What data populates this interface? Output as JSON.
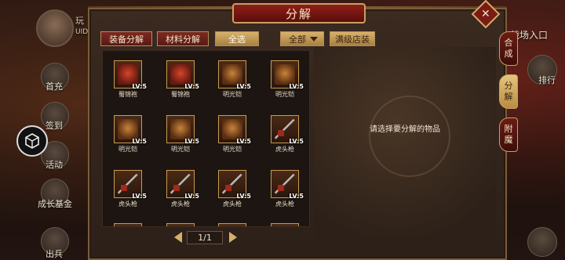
{
  "window": {
    "title": "分解",
    "close_label": "✕"
  },
  "hud": {
    "left_name": "玩",
    "left_uid": "UID",
    "left_buttons": [
      "首充",
      "签到",
      "活动",
      "成长基金",
      "出兵"
    ],
    "right_title": "战场入口",
    "right_buttons": [
      "排行"
    ]
  },
  "toolbar": {
    "equip_decompose": "装备分解",
    "material_decompose": "材料分解",
    "select_all": "全选",
    "filter_value": "全部",
    "max_shop": "满级店装"
  },
  "items": [
    {
      "name": "蜀锦袍",
      "level": "LV:5",
      "icon": "robe-icon"
    },
    {
      "name": "蜀锦袍",
      "level": "LV:5",
      "icon": "robe-icon"
    },
    {
      "name": "明光铠",
      "level": "LV:5",
      "icon": "armor-icon"
    },
    {
      "name": "明光铠",
      "level": "LV:5",
      "icon": "armor-icon"
    },
    {
      "name": "明光铠",
      "level": "LV:5",
      "icon": "armor-icon"
    },
    {
      "name": "明光铠",
      "level": "LV:5",
      "icon": "armor-icon"
    },
    {
      "name": "明光铠",
      "level": "LV:5",
      "icon": "armor-icon"
    },
    {
      "name": "虎头枪",
      "level": "LV:5",
      "icon": "spear-icon"
    },
    {
      "name": "虎头枪",
      "level": "LV:5",
      "icon": "spear-icon"
    },
    {
      "name": "虎头枪",
      "level": "LV:5",
      "icon": "spear-icon"
    },
    {
      "name": "虎头枪",
      "level": "LV:5",
      "icon": "spear-icon"
    },
    {
      "name": "虎头枪",
      "level": "LV:5",
      "icon": "spear-icon"
    }
  ],
  "pagination": {
    "text": "1/1"
  },
  "detail": {
    "hint": "请选择要分解的物品"
  },
  "side_tabs": [
    {
      "label": "合成",
      "active": false
    },
    {
      "label": "分解",
      "active": true
    },
    {
      "label": "附魔",
      "active": false
    }
  ]
}
